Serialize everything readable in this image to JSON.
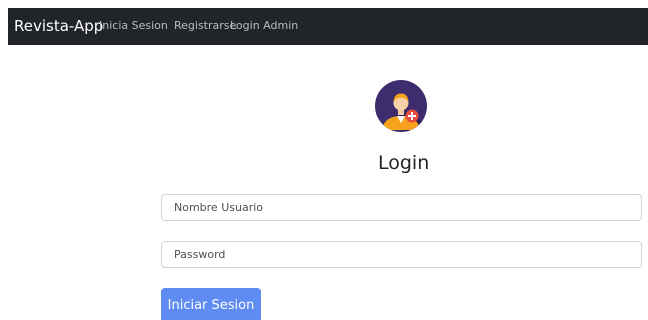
{
  "navbar": {
    "brand": "Revista-App",
    "links": [
      "Inicia Sesion",
      "Registrarse",
      "Login Admin"
    ],
    "background_color": "#212529"
  },
  "login": {
    "avatar_icon": "user-add-icon",
    "title": "Login",
    "username_placeholder": "Nombre Usuario",
    "password_placeholder": "Password",
    "submit_label": "Iniciar Sesion",
    "button_color": "#5e8cf2"
  }
}
